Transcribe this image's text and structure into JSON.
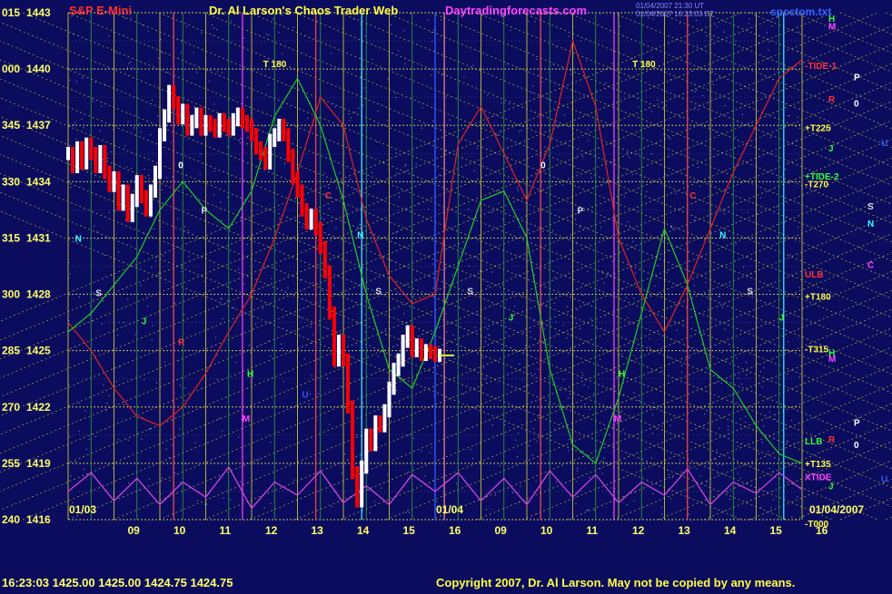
{
  "header": {
    "symbol": "S&P E-Mini",
    "title": "Dr. Al Larson's Chaos Trader Web",
    "site": "Daytradingforecasts.com",
    "timestamp1": "01/04/2007 21:30 UT",
    "timestamp2": "01/04/2007 16:23:03 ET",
    "file": "spcctom.txt"
  },
  "footer": {
    "quote": "16:23:03  1425.00  1425.00  1424.75  1424.75",
    "copyright": "Copyright 2007, Dr. Al Larson. May not be copied by any means."
  },
  "colors": {
    "background": "#0c0c5e",
    "price_up": "#ffffff",
    "price_down": "#ff0000",
    "forecast_red": "#dd2222",
    "forecast_green": "#22cc22",
    "xtide": "#cc44dd",
    "grid_yellow": "#e8e840",
    "time_line_yellow": "#cccc33",
    "time_line_green": "#33bb33"
  },
  "chart_data": {
    "type": "line",
    "title": "S&P E-Mini",
    "ylim": [
      1416,
      1443
    ],
    "y_ticks": [
      {
        "angle": "015",
        "price": 1443
      },
      {
        "angle": "000",
        "price": 1440
      },
      {
        "angle": "345",
        "price": 1437
      },
      {
        "angle": "330",
        "price": 1434
      },
      {
        "angle": "315",
        "price": 1431
      },
      {
        "angle": "300",
        "price": 1428
      },
      {
        "angle": "285",
        "price": 1425
      },
      {
        "angle": "270",
        "price": 1422
      },
      {
        "angle": "255",
        "price": 1419
      },
      {
        "angle": "240",
        "price": 1416
      }
    ],
    "x_ticks_day1": [
      "09",
      "10",
      "11",
      "12",
      "13",
      "14",
      "15",
      "16"
    ],
    "x_ticks_day2": [
      "09",
      "10",
      "11",
      "12",
      "13",
      "14",
      "15",
      "16"
    ],
    "date_labels": [
      "01/03",
      "01/04",
      "01/04/2007"
    ],
    "price_bars": {
      "x": [
        8.0,
        8.1,
        8.2,
        8.3,
        8.4,
        8.5,
        8.6,
        8.7,
        8.8,
        8.9,
        9.0,
        9.1,
        9.2,
        9.3,
        9.4,
        9.5,
        9.6,
        9.7,
        9.8,
        9.9,
        10.0,
        10.1,
        10.2,
        10.3,
        10.4,
        10.5,
        10.6,
        10.7,
        10.8,
        10.9,
        11.0,
        11.1,
        11.2,
        11.3,
        11.4,
        11.5,
        11.6,
        11.7,
        11.8,
        11.9,
        12.0,
        12.1,
        12.2,
        12.3,
        12.4,
        12.5,
        12.6,
        12.7,
        12.8,
        12.9,
        13.0,
        13.1,
        13.2,
        13.3,
        13.4,
        13.5,
        13.6,
        13.7,
        13.8,
        13.9,
        14.0,
        14.1,
        14.2,
        14.3,
        14.4,
        14.5,
        14.6,
        14.7,
        14.8,
        14.9,
        15.0,
        15.1,
        15.2,
        15.3,
        15.4,
        15.5,
        15.6,
        15.7,
        15.8,
        15.9,
        16.0,
        16.1
      ],
      "close": [
        1435.5,
        1434.8,
        1435.8,
        1435.0,
        1436.0,
        1435.5,
        1434.8,
        1435.6,
        1434.5,
        1433.8,
        1434.2,
        1432.8,
        1433.5,
        1432.2,
        1433.0,
        1434.0,
        1433.2,
        1432.5,
        1433.5,
        1434.5,
        1436.5,
        1437.5,
        1438.8,
        1438.2,
        1437.4,
        1437.8,
        1436.8,
        1437.2,
        1437.6,
        1436.8,
        1437.2,
        1437.0,
        1436.7,
        1437.3,
        1437.0,
        1436.8,
        1437.3,
        1437.6,
        1437.2,
        1437.0,
        1436.5,
        1435.8,
        1435.5,
        1435.0,
        1436.2,
        1436.5,
        1437.0,
        1436.5,
        1435.4,
        1434.2,
        1433.5,
        1432.5,
        1431.8,
        1432.2,
        1431.5,
        1430.5,
        1429.2,
        1427.0,
        1424.5,
        1425.5,
        1424.5,
        1422.0,
        1418.5,
        1417.0,
        1418.8,
        1420.5,
        1420.0,
        1421.2,
        1421.0,
        1421.8,
        1423.0,
        1424.0,
        1424.5,
        1425.5,
        1426.0,
        1425.0,
        1425.3,
        1424.8,
        1425.0,
        1424.9,
        1424.75,
        1424.75
      ]
    },
    "forecast_red": {
      "x": [
        8.0,
        8.5,
        9.0,
        9.5,
        10.0,
        10.5,
        11.0,
        11.5,
        12.0,
        12.5,
        13.0,
        13.5,
        14.0,
        14.5,
        15.0,
        15.5,
        16.0,
        16.5,
        17.0,
        17.5,
        18.0,
        18.5,
        19.0,
        19.5,
        20.0,
        20.5,
        21.0,
        21.5,
        22.0,
        22.5,
        23.0,
        23.5,
        24.0
      ],
      "y": [
        1426.5,
        1425.0,
        1423.0,
        1421.5,
        1421.0,
        1422.0,
        1423.8,
        1426.0,
        1428.0,
        1431.0,
        1434.5,
        1438.5,
        1437.0,
        1432.0,
        1429.0,
        1427.5,
        1428.0,
        1436.0,
        1438.0,
        1435.5,
        1433.0,
        1436.0,
        1441.5,
        1438.0,
        1431.0,
        1428.0,
        1426.0,
        1428.5,
        1431.5,
        1434.5,
        1437.0,
        1439.5,
        1440.5
      ]
    },
    "forecast_green": {
      "x": [
        8.0,
        8.5,
        9.0,
        9.5,
        10.0,
        10.5,
        11.0,
        11.5,
        12.0,
        12.5,
        13.0,
        13.5,
        14.0,
        14.5,
        15.0,
        15.5,
        16.0,
        16.5,
        17.0,
        17.5,
        18.0,
        18.5,
        19.0,
        19.5,
        20.0,
        20.5,
        21.0,
        21.5,
        22.0,
        22.5,
        23.0,
        23.5,
        24.0
      ],
      "y": [
        1426.0,
        1427.0,
        1428.5,
        1430.0,
        1432.5,
        1434.0,
        1432.5,
        1431.5,
        1433.5,
        1437.5,
        1439.5,
        1437.0,
        1433.0,
        1428.0,
        1424.0,
        1423.0,
        1426.0,
        1429.5,
        1433.0,
        1433.5,
        1431.0,
        1424.0,
        1420.0,
        1419.0,
        1422.5,
        1427.0,
        1431.5,
        1428.5,
        1424.0,
        1423.0,
        1421.0,
        1419.5,
        1419.0
      ]
    },
    "xtide_oscillator": {
      "x": [
        8.0,
        8.5,
        9.0,
        9.5,
        10.0,
        10.5,
        11.0,
        11.5,
        12.0,
        12.5,
        13.0,
        13.5,
        14.0,
        14.5,
        15.0,
        15.5,
        16.0,
        16.5,
        17.0,
        17.5,
        18.0,
        18.5,
        19.0,
        19.5,
        20.0,
        20.5,
        21.0,
        21.5,
        22.0,
        22.5,
        23.0,
        23.5,
        24.0
      ],
      "y": [
        1417.5,
        1418.5,
        1417.0,
        1418.2,
        1416.8,
        1418.0,
        1417.2,
        1418.8,
        1416.6,
        1418.0,
        1417.3,
        1418.6,
        1416.9,
        1417.8,
        1416.8,
        1418.4,
        1417.5,
        1418.5,
        1417.0,
        1418.2,
        1416.8,
        1418.6,
        1417.2,
        1418.4,
        1416.9,
        1418.0,
        1417.3,
        1418.7,
        1416.8,
        1418.0,
        1417.4,
        1418.5,
        1417.6
      ]
    },
    "right_labels": [
      {
        "text": "H",
        "price": 1442.7,
        "color": "#33ff33"
      },
      {
        "text": "M",
        "price": 1442.3,
        "color": "#ff44ff"
      },
      {
        "text": "-TIDE-1",
        "price": 1440.2,
        "color": "#ff3333"
      },
      {
        "text": "R",
        "price": 1438.4,
        "color": "#ff3333"
      },
      {
        "text": "+T225",
        "price": 1436.9,
        "color": "#ffff44"
      },
      {
        "text": "J",
        "price": 1435.8,
        "color": "#33ff33"
      },
      {
        "text": "+TIDE-2",
        "price": 1434.3,
        "color": "#33ff33"
      },
      {
        "text": "-T270",
        "price": 1433.9,
        "color": "#ffff44"
      },
      {
        "text": "ULB",
        "price": 1429.1,
        "color": "#ff3333"
      },
      {
        "text": "+T180",
        "price": 1427.9,
        "color": "#ffff44"
      },
      {
        "text": "-T315",
        "price": 1425.1,
        "color": "#ffff44"
      },
      {
        "text": "M",
        "price": 1424.6,
        "color": "#ff44ff"
      },
      {
        "text": "H",
        "price": 1424.9,
        "color": "#33ff33"
      },
      {
        "text": "R",
        "price": 1420.3,
        "color": "#ff3333"
      },
      {
        "text": "LLB",
        "price": 1420.2,
        "color": "#33ff33"
      },
      {
        "text": "+T135",
        "price": 1419.0,
        "color": "#ffff44"
      },
      {
        "text": "XTIDE",
        "price": 1418.3,
        "color": "#ff44ff"
      },
      {
        "text": "J",
        "price": 1417.8,
        "color": "#33ff33"
      },
      {
        "text": "-T000",
        "price": 1415.8,
        "color": "#ffff44"
      }
    ],
    "far_right_labels": [
      {
        "text": "P",
        "price": 1439.6,
        "color": "#ffffff"
      },
      {
        "text": "0",
        "price": 1438.2,
        "color": "#ffffff"
      },
      {
        "text": "U",
        "price": 1436.1,
        "color": "#3355ff"
      },
      {
        "text": "S",
        "price": 1432.7,
        "color": "#dddddd"
      },
      {
        "text": "N",
        "price": 1431.8,
        "color": "#33ffff"
      },
      {
        "text": "C",
        "price": 1429.6,
        "color": "#ff44ff"
      },
      {
        "text": "P",
        "price": 1421.2,
        "color": "#ffffff"
      },
      {
        "text": "0",
        "price": 1420.0,
        "color": "#ffffff"
      },
      {
        "text": "U",
        "price": 1418.2,
        "color": "#3355ff"
      }
    ],
    "planet_markers": [
      {
        "text": "N",
        "x": 8.15,
        "price": 1431.0,
        "color": "#33ffff"
      },
      {
        "text": "S",
        "x": 8.6,
        "price": 1428.1,
        "color": "#dddddd"
      },
      {
        "text": "J",
        "x": 9.6,
        "price": 1426.6,
        "color": "#33ff33"
      },
      {
        "text": "R",
        "x": 10.4,
        "price": 1425.5,
        "color": "#ff3333"
      },
      {
        "text": "0",
        "x": 10.4,
        "price": 1434.9,
        "color": "#ffffff"
      },
      {
        "text": "P",
        "x": 10.9,
        "price": 1432.5,
        "color": "#dddddd"
      },
      {
        "text": "H",
        "x": 11.9,
        "price": 1423.8,
        "color": "#33ff33"
      },
      {
        "text": "M",
        "x": 11.8,
        "price": 1421.4,
        "color": "#ff44ff"
      },
      {
        "text": "T 180",
        "x": 12.25,
        "price": 1440.3,
        "color": "#ffff44"
      },
      {
        "text": "U",
        "x": 13.1,
        "price": 1422.7,
        "color": "#3355ff"
      },
      {
        "text": "C",
        "x": 13.6,
        "price": 1433.3,
        "color": "#ff3333"
      },
      {
        "text": "N",
        "x": 14.3,
        "price": 1431.2,
        "color": "#33ffff"
      },
      {
        "text": "S",
        "x": 14.7,
        "price": 1428.2,
        "color": "#dddddd"
      },
      {
        "text": "S",
        "x": 16.7,
        "price": 1428.2,
        "color": "#dddddd"
      },
      {
        "text": "J",
        "x": 17.6,
        "price": 1426.8,
        "color": "#33ff33"
      },
      {
        "text": "0",
        "x": 18.3,
        "price": 1434.9,
        "color": "#ffffff"
      },
      {
        "text": "P",
        "x": 19.1,
        "price": 1432.5,
        "color": "#dddddd"
      },
      {
        "text": "H",
        "x": 20.0,
        "price": 1423.8,
        "color": "#33ff33"
      },
      {
        "text": "M",
        "x": 19.9,
        "price": 1421.4,
        "color": "#ff44ff"
      },
      {
        "text": "T 180",
        "x": 20.3,
        "price": 1440.3,
        "color": "#ffff44"
      },
      {
        "text": "C",
        "x": 21.55,
        "price": 1433.3,
        "color": "#ff3333"
      },
      {
        "text": "N",
        "x": 22.2,
        "price": 1431.2,
        "color": "#33ffff"
      },
      {
        "text": "S",
        "x": 22.8,
        "price": 1428.2,
        "color": "#dddddd"
      },
      {
        "text": "J",
        "x": 23.5,
        "price": 1426.8,
        "color": "#33ff33"
      }
    ]
  }
}
